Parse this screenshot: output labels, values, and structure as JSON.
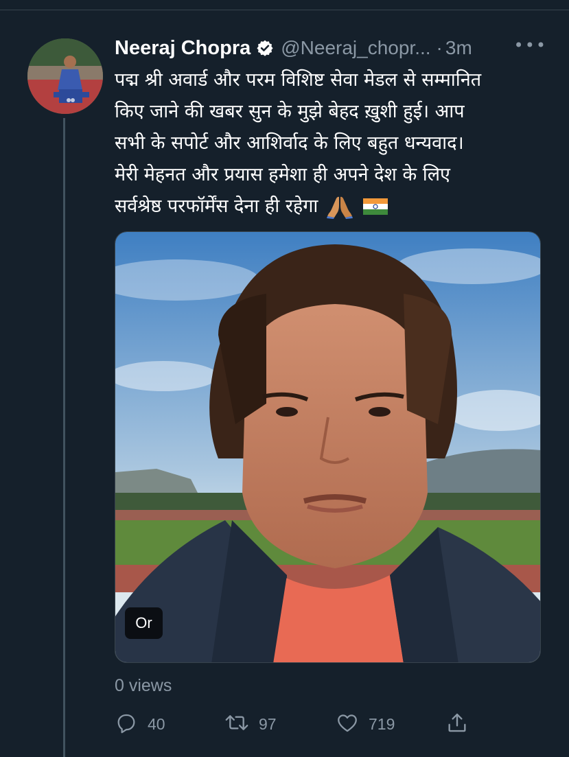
{
  "tweet": {
    "author_name": "Neeraj Chopra",
    "handle": "@Neeraj_chopr...",
    "separator": "·",
    "time": "3m",
    "more_label": "•••",
    "text_lines": [
      "पद्म श्री अवार्ड और परम विशिष्ट सेवा मेडल से सम्मानित",
      "किए जाने की खबर सुन के मुझे बेहद ख़ुशी हुई। आप",
      "सभी के सपोर्ट और आशिर्वाद के लिए बहुत धन्यवाद।",
      "मेरी मेहनत और प्रयास हमेशा ही अपने देश के लिए",
      "सर्वश्रेष्ठ परफॉर्मेंस देना ही रहेगा"
    ],
    "emojis": [
      "folded-hands-emoji",
      "india-flag-emoji"
    ],
    "media_alt_badge": "Or",
    "views": "0 views",
    "actions": {
      "reply_count": "40",
      "retweet_count": "97",
      "like_count": "719"
    }
  },
  "colors": {
    "background": "#15202b",
    "text_primary": "#ffffff",
    "text_secondary": "#8b98a5",
    "verified_badge": "#ffffff",
    "thread_line": "#42535f"
  },
  "icons": [
    "verified-badge-icon",
    "more-options-icon",
    "reply-icon",
    "retweet-icon",
    "like-icon",
    "share-icon"
  ]
}
